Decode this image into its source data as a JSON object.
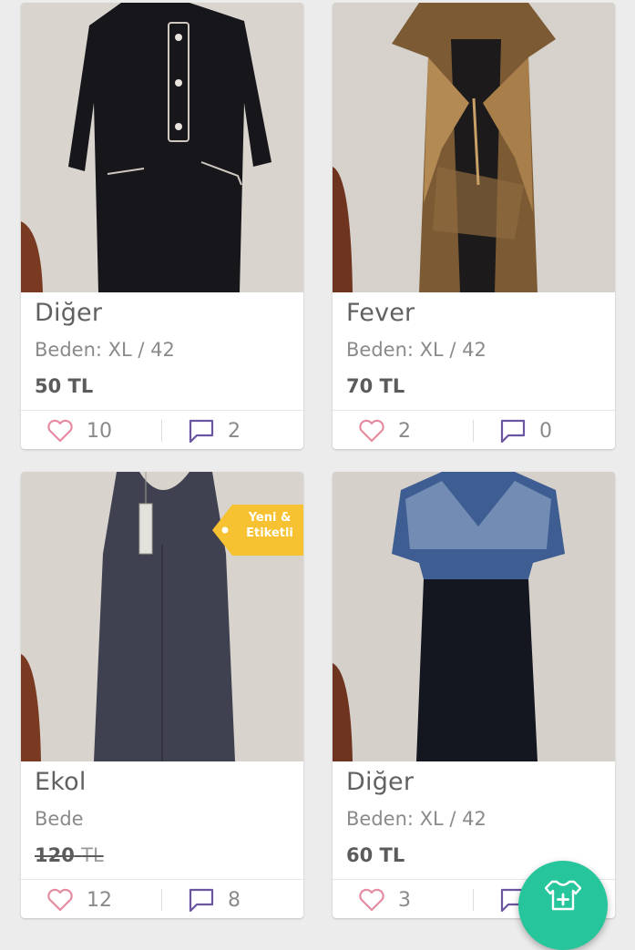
{
  "products": [
    {
      "brand": "Diğer",
      "size": "Beden: XL / 42",
      "price": "50 TL",
      "likes": "10",
      "comments": "2"
    },
    {
      "brand": "Fever",
      "size": "Beden: XL / 42",
      "price": "70 TL",
      "likes": "2",
      "comments": "0"
    },
    {
      "brand": "Ekol",
      "size": "Bede",
      "price": "120",
      "currency": "TL",
      "likes": "12",
      "comments": "8",
      "badge_line1": "Yeni &",
      "badge_line2": "Etiketli"
    },
    {
      "brand": "Diğer",
      "size": "Beden: XL / 42",
      "price": "60 TL",
      "likes": "3",
      "comments": ""
    }
  ],
  "colors": {
    "accent_fab": "#26c59b",
    "badge": "#f6c231",
    "like_icon": "#e58b9f",
    "comment_icon": "#6a55a0"
  },
  "icons": {
    "like": "heart-outline-icon",
    "comment": "speech-bubble-icon",
    "fab": "add-clothing-icon"
  }
}
